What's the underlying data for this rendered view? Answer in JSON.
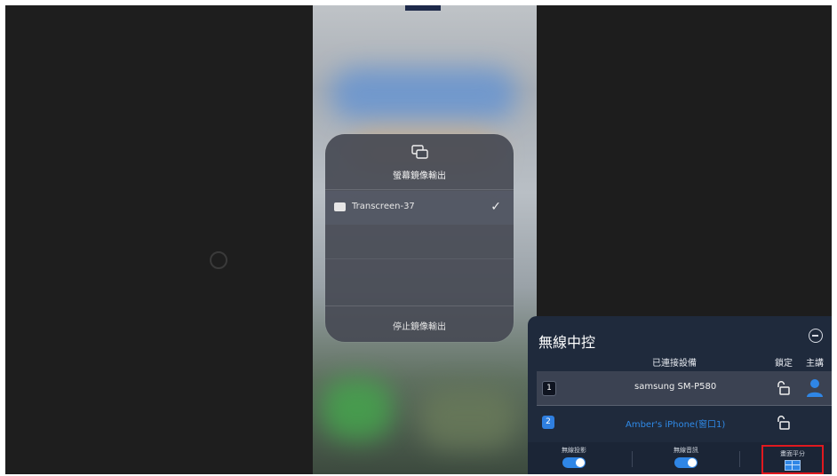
{
  "mirroring": {
    "title": "螢幕鏡像輸出",
    "device_name": "Transcreen-37",
    "device_selected": true,
    "stop_label": "停止鏡像輸出"
  },
  "control_panel": {
    "title": "無線中控",
    "col_connected": "已連接設備",
    "col_lock": "鎖定",
    "col_host": "主講",
    "devices": [
      {
        "number": "1",
        "name": "samsung SM-P580",
        "locked": false,
        "host": true
      },
      {
        "number": "2",
        "name": "Amber's iPhone(窗口1)",
        "locked": false,
        "host": false
      }
    ],
    "bottom": [
      {
        "label": "無線投影",
        "toggle_on": true
      },
      {
        "label": "無線音訊",
        "toggle_on": true
      },
      {
        "label": "畫面平分"
      }
    ]
  },
  "colors": {
    "accent": "#2f86e6",
    "highlight_border": "#e0191f",
    "panel_bg": "#1f2a3c"
  },
  "icons": [
    "screen-mirroring-icon",
    "tv-icon",
    "checkmark-icon",
    "minus-circle-icon",
    "unlock-icon",
    "user-icon",
    "split-screen-icon"
  ]
}
